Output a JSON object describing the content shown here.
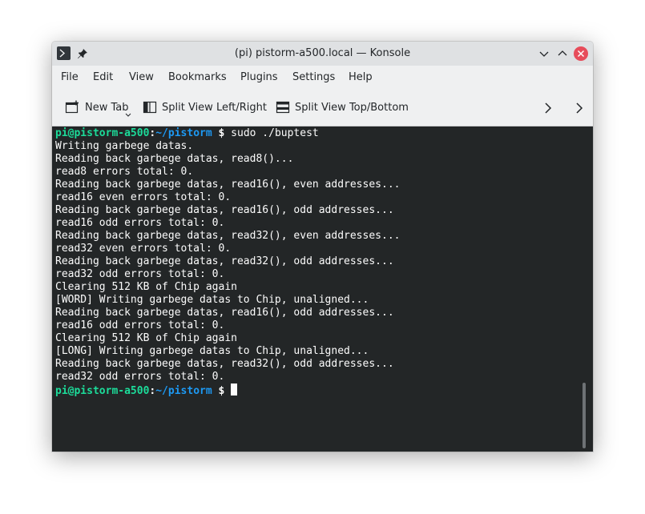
{
  "window": {
    "title": "(pi) pistorm-a500.local — Konsole"
  },
  "menubar": {
    "items": [
      {
        "label": "File"
      },
      {
        "label": "Edit"
      },
      {
        "label": "View"
      },
      {
        "label": "Bookmarks"
      },
      {
        "label": "Plugins"
      },
      {
        "label": "Settings"
      },
      {
        "label": "Help"
      }
    ]
  },
  "toolbar": {
    "new_tab": "New Tab",
    "split_lr": "Split View Left/Right",
    "split_tb": "Split View Top/Bottom"
  },
  "terminal": {
    "prompt_user": "pi@pistorm-a500",
    "prompt_colon": ":",
    "prompt_path": "~/pistorm",
    "prompt_symbol": " $",
    "command": " sudo ./buptest",
    "output": [
      "Writing garbege datas.",
      "Reading back garbege datas, read8()...",
      "read8 errors total: 0.",
      "Reading back garbege datas, read16(), even addresses...",
      "read16 even errors total: 0.",
      "Reading back garbege datas, read16(), odd addresses...",
      "read16 odd errors total: 0.",
      "Reading back garbege datas, read32(), even addresses...",
      "read32 even errors total: 0.",
      "Reading back garbege datas, read32(), odd addresses...",
      "read32 odd errors total: 0.",
      "Clearing 512 KB of Chip again",
      "[WORD] Writing garbege datas to Chip, unaligned...",
      "Reading back garbege datas, read16(), odd addresses...",
      "read16 odd errors total: 0.",
      "Clearing 512 KB of Chip again",
      "[LONG] Writing garbege datas to Chip, unaligned...",
      "Reading back garbege datas, read32(), odd addresses...",
      "read32 odd errors total: 0."
    ],
    "colors": {
      "background": "#232627",
      "foreground": "#fcfcfc",
      "user": "#1cdc9a",
      "path": "#1d99f3"
    }
  }
}
